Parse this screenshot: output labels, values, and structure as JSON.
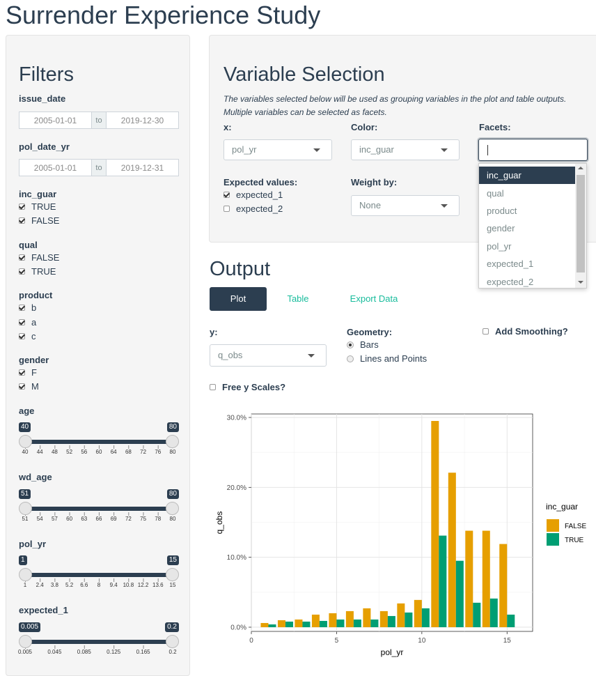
{
  "app": {
    "title": "Surrender Experience Study"
  },
  "filters": {
    "heading": "Filters",
    "issue_date": {
      "label": "issue_date",
      "start": "2005-01-01",
      "sep": "to",
      "end": "2019-12-30"
    },
    "pol_date_yr": {
      "label": "pol_date_yr",
      "start": "2005-01-01",
      "sep": "to",
      "end": "2019-12-31"
    },
    "inc_guar": {
      "label": "inc_guar",
      "options": [
        "TRUE",
        "FALSE"
      ]
    },
    "qual": {
      "label": "qual",
      "options": [
        "FALSE",
        "TRUE"
      ]
    },
    "product": {
      "label": "product",
      "options": [
        "b",
        "a",
        "c"
      ]
    },
    "gender": {
      "label": "gender",
      "options": [
        "F",
        "M"
      ]
    },
    "age": {
      "label": "age",
      "min": "40",
      "max": "80",
      "value_low": 40,
      "value_high": 80,
      "ticks": [
        "40",
        "44",
        "48",
        "52",
        "56",
        "60",
        "64",
        "68",
        "72",
        "76",
        "80"
      ]
    },
    "wd_age": {
      "label": "wd_age",
      "min": "51",
      "max": "80",
      "value_low": 51,
      "value_high": 80,
      "ticks": [
        "51",
        "54",
        "57",
        "60",
        "63",
        "66",
        "69",
        "72",
        "75",
        "78",
        "80"
      ]
    },
    "pol_yr": {
      "label": "pol_yr",
      "min": "1",
      "max": "15",
      "value_low": 1,
      "value_high": 15,
      "ticks": [
        "1",
        "2.4",
        "3.8",
        "5.2",
        "6.6",
        "8",
        "9.4",
        "10.8",
        "12.2",
        "13.6",
        "15"
      ]
    },
    "expected_1": {
      "label": "expected_1",
      "min": "0.005",
      "max": "0.2",
      "value_low": 0.005,
      "value_high": 0.2,
      "ticks": [
        "0.005",
        "0.045",
        "0.085",
        "0.125",
        "0.165",
        "0.2"
      ]
    }
  },
  "variable_selection": {
    "title": "Variable Selection",
    "description_1": "The variables selected below will be used as grouping variables in the plot and table outputs.",
    "description_2": "Multiple variables can be selected as facets.",
    "x_label": "x:",
    "x_value": "pol_yr",
    "color_label": "Color:",
    "color_value": "inc_guar",
    "facets_label": "Facets:",
    "facets_options": [
      "inc_guar",
      "qual",
      "product",
      "gender",
      "pol_yr",
      "expected_1",
      "expected_2"
    ],
    "expected_label": "Expected values:",
    "expected_options": [
      {
        "label": "expected_1",
        "checked": true
      },
      {
        "label": "expected_2",
        "checked": false
      }
    ],
    "weight_label": "Weight by:",
    "weight_value": "None"
  },
  "output": {
    "title": "Output",
    "tabs": [
      "Plot",
      "Table",
      "Export Data"
    ],
    "y_label": "y:",
    "y_value": "q_obs",
    "geometry_label": "Geometry:",
    "geometry_options": [
      "Bars",
      "Lines and Points"
    ],
    "smoothing_label": "Add Smoothing?",
    "free_y_label": "Free y Scales?"
  },
  "colors": {
    "false": "#E69F00",
    "true": "#009E73",
    "primary": "#2c3e50",
    "accent": "#18bc9c"
  },
  "chart_data": {
    "type": "bar",
    "xlabel": "pol_yr",
    "ylabel": "q_obs",
    "x": [
      1,
      2,
      3,
      4,
      5,
      6,
      7,
      8,
      9,
      10,
      11,
      12,
      13,
      14,
      15
    ],
    "xlim": [
      0,
      16.5
    ],
    "ylim": [
      -0.006,
      0.305
    ],
    "xticks": [
      0,
      5,
      10,
      15
    ],
    "yticks": [
      0,
      0.1,
      0.2,
      0.3
    ],
    "ytick_labels": [
      "0.0%",
      "10.0%",
      "20.0%",
      "30.0%"
    ],
    "legend_title": "inc_guar",
    "legend_position": "right",
    "grid": true,
    "series": [
      {
        "name": "FALSE",
        "values": [
          0.006,
          0.01,
          0.011,
          0.018,
          0.02,
          0.023,
          0.027,
          0.023,
          0.034,
          0.039,
          0.295,
          0.221,
          0.138,
          0.138,
          0.119
        ]
      },
      {
        "name": "TRUE",
        "values": [
          0.004,
          0.008,
          0.008,
          0.009,
          0.011,
          0.011,
          0.011,
          0.016,
          0.021,
          0.027,
          0.131,
          0.095,
          0.035,
          0.041,
          0.018
        ]
      }
    ]
  }
}
